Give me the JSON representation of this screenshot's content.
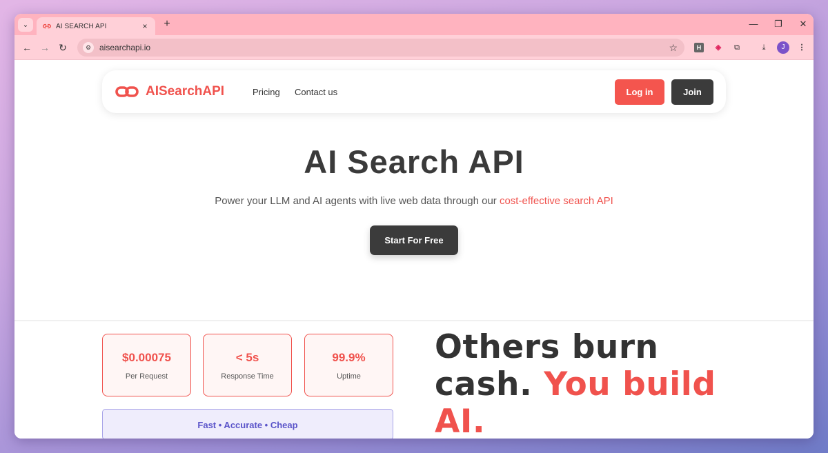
{
  "browser": {
    "tab_title": "AI SEARCH API",
    "tab_close": "×",
    "new_tab": "+",
    "url": "aisearchapi.io",
    "avatar_initial": "J",
    "ext_h": "H"
  },
  "nav": {
    "brand": "AISearchAPI",
    "pricing": "Pricing",
    "contact": "Contact us",
    "login": "Log in",
    "join": "Join"
  },
  "hero": {
    "title": "AI Search API",
    "subtitle_prefix": "Power your LLM and AI agents with live web data through our ",
    "subtitle_accent": "cost-effective search API",
    "cta": "Start For Free"
  },
  "stats": [
    {
      "value": "$0.00075",
      "label": "Per Request"
    },
    {
      "value": "< 5s",
      "label": "Response Time"
    },
    {
      "value": "99.9%",
      "label": "Uptime"
    }
  ],
  "tagline": "Fast • Accurate • Cheap",
  "slogan": {
    "part1": "Others burn cash. ",
    "part2": "You build AI."
  },
  "colors": {
    "accent": "#f0524d",
    "dark_button": "#3b3b3b",
    "tab_strip": "#ffb3bf"
  }
}
